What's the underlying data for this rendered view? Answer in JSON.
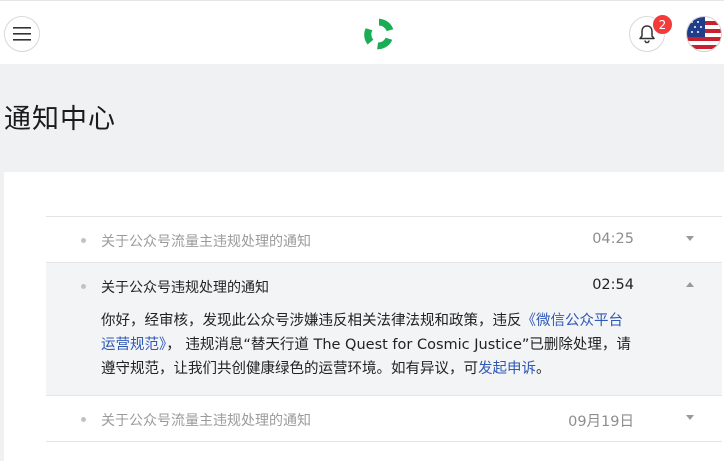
{
  "header": {
    "menu_icon": "hamburger-menu-icon",
    "logo_icon": "green-circular-arrows-logo",
    "bell_icon": "bell-icon",
    "badge_count": "2",
    "avatar_icon": "flag-avatar",
    "accent_color": "#1aad55",
    "badge_color": "#f43b3b"
  },
  "page": {
    "title": "通知中心"
  },
  "notifications": [
    {
      "title": "关于公众号流量主违规处理的通知",
      "time": "04:25",
      "expanded": false
    },
    {
      "title": "关于公众号违规处理的通知",
      "time": "02:54",
      "expanded": true,
      "body_part1": "你好，经审核，发现此公众号涉嫌违反相关法律法规和政策，违反",
      "body_link1": "《微信公众平台运营规范》",
      "body_part2": "，  违规消息“替天行道 The Quest for Cosmic Justice”已删除处理，请遵守规范，让我们共创健康绿色的运营环境。如有异议，可",
      "body_link2": "发起申诉",
      "body_part3": "。"
    },
    {
      "title": "关于公众号流量主违规处理的通知",
      "time": "09月19日",
      "expanded": false
    }
  ]
}
